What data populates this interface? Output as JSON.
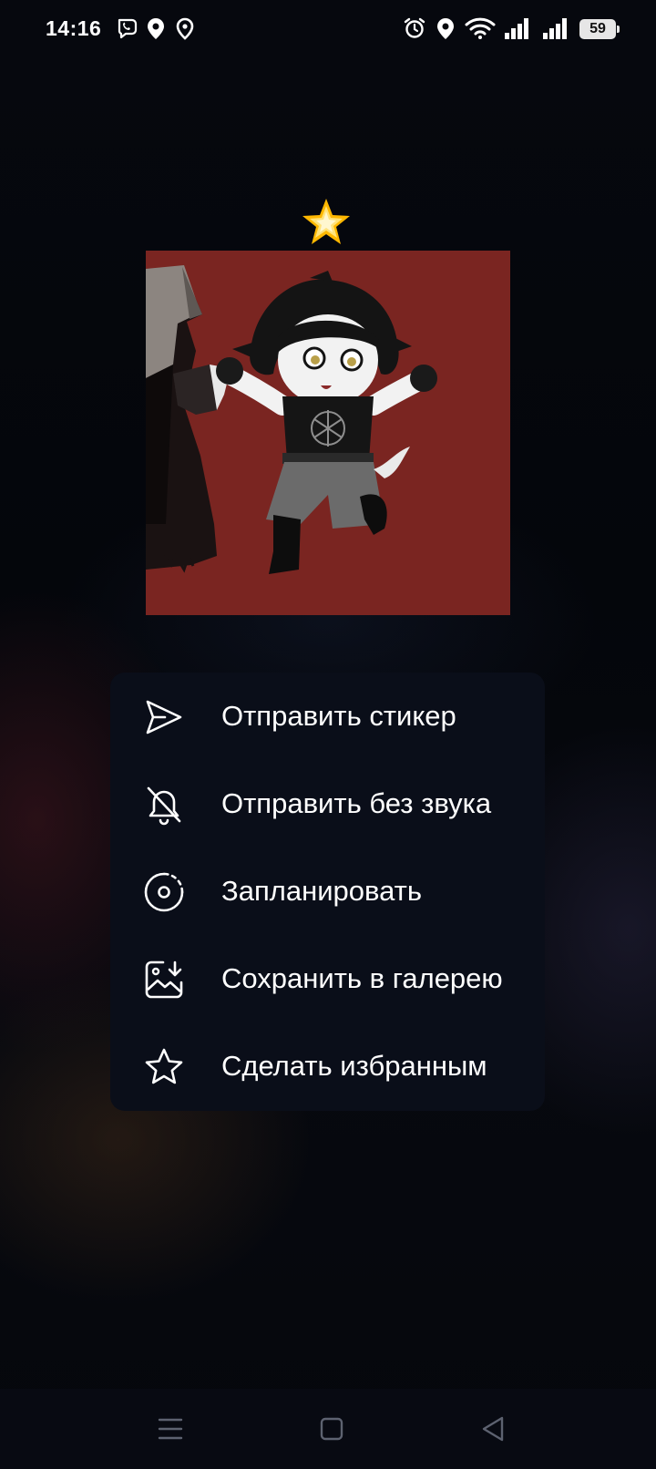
{
  "status_bar": {
    "time": "14:16",
    "battery": "59",
    "left_icons": [
      "viber-icon",
      "location-icon",
      "location-icon"
    ],
    "right_icons": [
      "alarm-icon",
      "location-icon",
      "wifi-icon",
      "signal-icon",
      "signal-icon",
      "battery-icon"
    ]
  },
  "sticker": {
    "emoji": "🌟"
  },
  "menu": {
    "items": [
      {
        "label": "Отправить стикер",
        "icon": "send-icon"
      },
      {
        "label": "Отправить без звука",
        "icon": "bell-off-icon"
      },
      {
        "label": "Запланировать",
        "icon": "schedule-icon"
      },
      {
        "label": "Сохранить в галерею",
        "icon": "save-to-gallery-icon"
      },
      {
        "label": "Сделать избранным",
        "icon": "star-icon"
      }
    ]
  },
  "nav_bar": {
    "buttons": [
      "menu-icon",
      "home-icon",
      "back-icon"
    ]
  },
  "colors": {
    "menu_background": "#0a0e19",
    "sticker_background": "#7a2521",
    "text": "#ffffff"
  }
}
